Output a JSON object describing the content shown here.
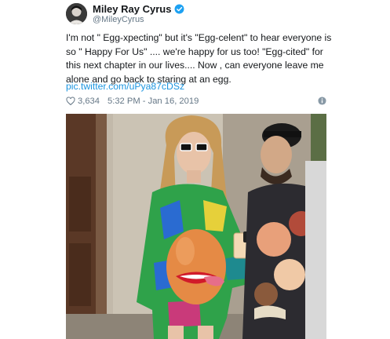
{
  "user": {
    "display_name": "Miley Ray Cyrus",
    "handle": "@MileyCyrus",
    "avatar_icon": "profile-avatar",
    "verified_icon": "verified-badge-icon"
  },
  "tweet": {
    "lines": [
      "I'm not \" Egg-xpecting\" but it's \"Egg-celent\" to hear everyone is",
      "so \" Happy For Us\" .... we're happy for us too! \"Egg-cited\" for",
      "this next chapter in our lives.... Now , can everyone leave me",
      "alone and go back to staring at an egg."
    ],
    "link": "pic.twitter.com/uPya87cDSz"
  },
  "meta": {
    "likes": "3,634",
    "timestamp": "5:32 PM - Jan 16, 2019"
  },
  "icons": {
    "like": "heart-icon",
    "info": "info-icon"
  },
  "colors": {
    "link": "#1b95e0",
    "verified": "#1da1f2",
    "secondary_text": "#657786"
  }
}
